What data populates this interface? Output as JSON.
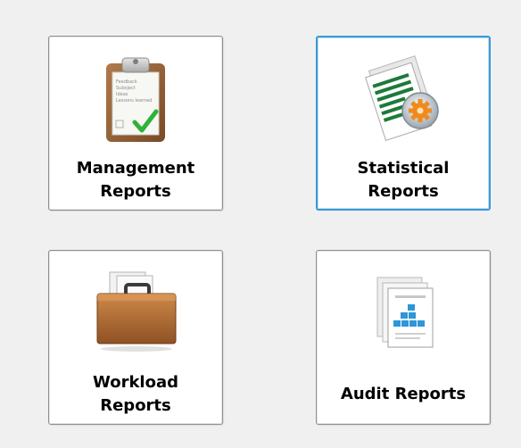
{
  "colors": {
    "background": "#f0f0f0",
    "tile_background": "#ffffff",
    "tile_border": "#8f8f8f",
    "selected_border": "#3c98d6"
  },
  "tiles": [
    {
      "label": "Management\nReports",
      "icon": "clipboard-checklist-icon",
      "selected": false
    },
    {
      "label": "Statistical\nReports",
      "icon": "report-pages-gear-icon",
      "selected": true
    },
    {
      "label": "Workload\nReports",
      "icon": "briefcase-icon",
      "selected": false
    },
    {
      "label": "Audit Reports",
      "icon": "document-chart-icon",
      "selected": false
    }
  ],
  "clipboard_text": [
    "Feedback",
    "Suboject",
    "Ideas",
    "Lessons learned"
  ]
}
